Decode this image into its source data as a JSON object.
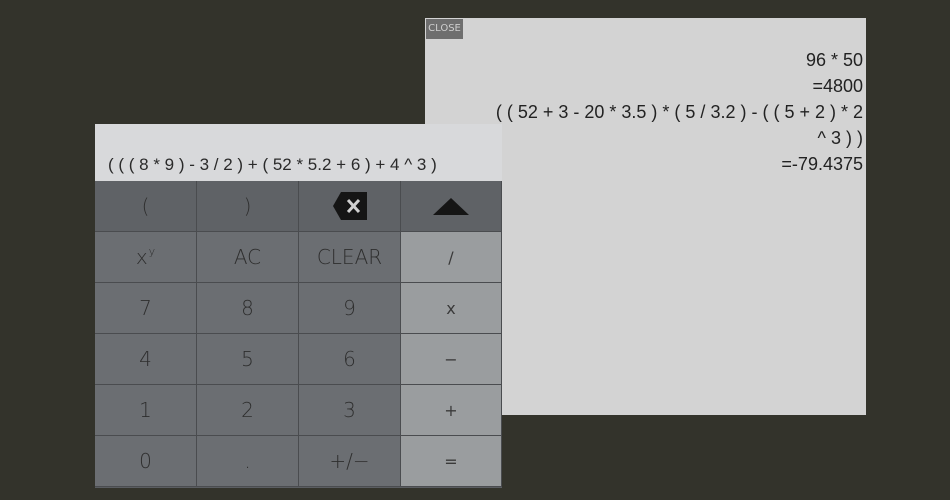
{
  "history": {
    "close_label": "CLOSE",
    "lines": [
      "96 * 50",
      "=4800",
      "( ( 52 + 3 - 20 * 3.5 ) * ( 5 / 3.2 ) - ( ( 5 + 2 ) * 2",
      "^ 3 ) )",
      "=-79.4375"
    ]
  },
  "calculator": {
    "expression": "( ( ( 8 * 9 ) - 3 / 2 ) + ( 52 * 5.2 + 6 ) + 4 ^ 3 )",
    "keys": {
      "open_paren": "(",
      "close_paren": ")",
      "backspace_icon": "backspace-icon",
      "up_icon": "caret-up-icon",
      "power_base": "x",
      "power_exp": "y",
      "ac": "AC",
      "clear": "CLEAR",
      "divide": "/",
      "seven": "7",
      "eight": "8",
      "nine": "9",
      "multiply": "x",
      "four": "4",
      "five": "5",
      "six": "6",
      "minus": "−",
      "one": "1",
      "two": "2",
      "three": "3",
      "plus": "+",
      "zero": "0",
      "dot": ".",
      "sign": "+/−",
      "equals": "="
    }
  }
}
